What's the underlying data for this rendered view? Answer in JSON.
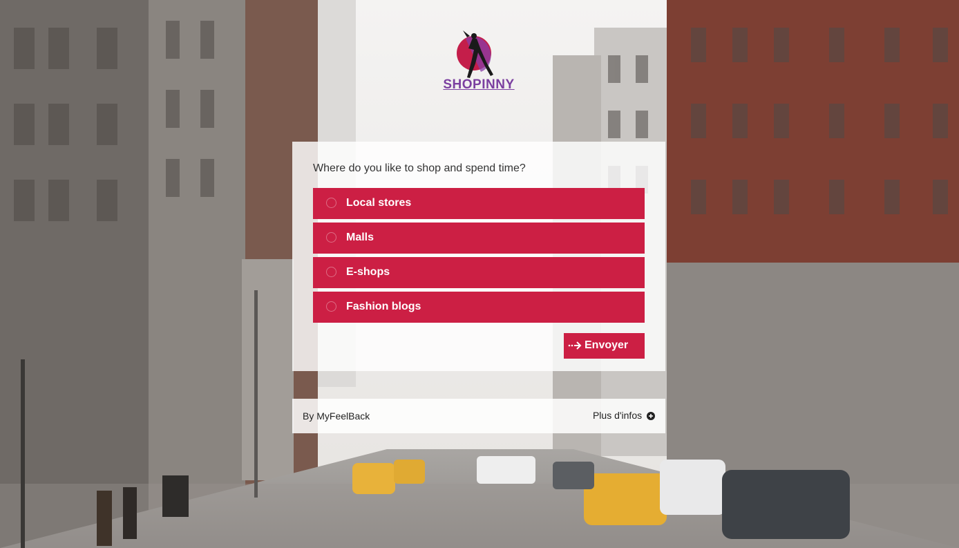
{
  "brand": {
    "name": "SHOPINNY",
    "logo_icon": "fashion-figure-logo",
    "logo_color": "#7b3fa0"
  },
  "survey": {
    "question": "Where do you like to shop and spend time?",
    "options": [
      {
        "label": "Local stores"
      },
      {
        "label": "Malls"
      },
      {
        "label": "E-shops"
      },
      {
        "label": "Fashion blogs"
      }
    ],
    "submit_label": "Envoyer",
    "submit_icon": "arrow-right-icon",
    "accent_color": "#cc1f44"
  },
  "footer": {
    "by_label": "By MyFeelBack",
    "more_label": "Plus d'infos",
    "more_icon": "plus-circle-icon"
  }
}
